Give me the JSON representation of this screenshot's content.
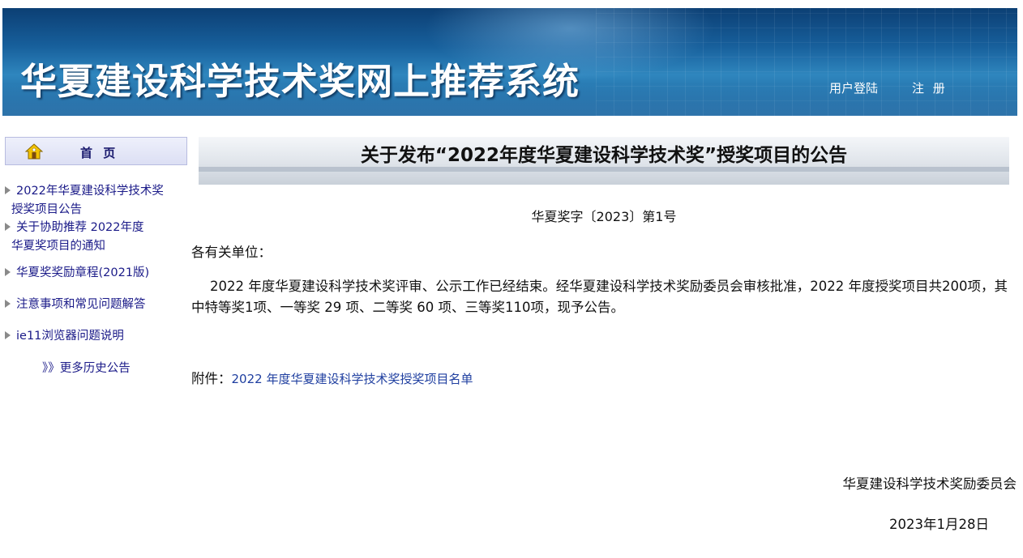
{
  "header": {
    "site_title": "华夏建设科学技术奖网上推荐系统",
    "login_label": "用户登陆",
    "register_label": "注 册"
  },
  "sidebar": {
    "home_label": "首 页",
    "home_icon": "home-icon",
    "items": [
      {
        "line1": "2022年华夏建设科学技术奖",
        "line2": "授奖项目公告"
      },
      {
        "line1": "关于协助推荐 2022年度",
        "line2": "华夏奖项目的通知"
      },
      {
        "line1": "华夏奖奖励章程(2021版)",
        "line2": ""
      },
      {
        "line1": "注意事项和常见问题解答",
        "line2": ""
      },
      {
        "line1": "ie11浏览器问题说明",
        "line2": ""
      }
    ],
    "more_link": "》》更多历史公告"
  },
  "notice": {
    "title": "关于发布“2022年度华夏建设科学技术奖”授奖项目的公告",
    "doc_number": "华夏奖字〔2023〕第1号",
    "salutation": "各有关单位：",
    "body": "2022 年度华夏建设科学技术奖评审、公示工作已经结束。经华夏建设科学技术奖励委员会审核批准，2022 年度授奖项目共200项，其中特等奖1项、一等奖 29 项、二等奖 60 项、三等奖110项，现予公告。",
    "attachment_label": "附件：",
    "attachment_link": "2022 年度华夏建设科学技术奖授奖项目名单",
    "signature": "华夏建设科学技术奖励委员会",
    "date": "2023年1月28日"
  }
}
